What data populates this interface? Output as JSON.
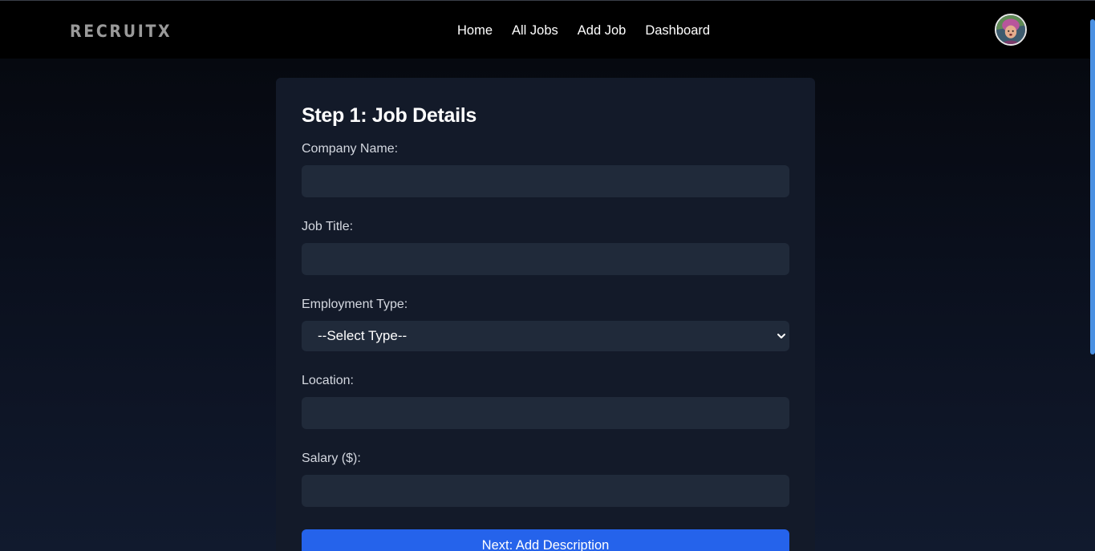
{
  "brand": {
    "logo_text": "RECRUITX"
  },
  "nav": {
    "items": [
      {
        "label": "Home"
      },
      {
        "label": "All Jobs"
      },
      {
        "label": "Add Job"
      },
      {
        "label": "Dashboard"
      }
    ]
  },
  "user": {
    "avatar_icon": "user-avatar"
  },
  "form": {
    "title": "Step 1: Job Details",
    "fields": {
      "company": {
        "label": "Company Name:",
        "value": "",
        "placeholder": ""
      },
      "job_title": {
        "label": "Job Title:",
        "value": "",
        "placeholder": ""
      },
      "employment_type": {
        "label": "Employment Type:",
        "selected": "--Select Type--"
      },
      "location": {
        "label": "Location:",
        "value": "",
        "placeholder": ""
      },
      "salary": {
        "label": "Salary ($):",
        "value": "",
        "placeholder": ""
      }
    },
    "submit_label": "Next: Add Description"
  },
  "colors": {
    "accent": "#2563eb",
    "navbar_bg": "#000000",
    "card_bg": "#131a29",
    "input_bg": "#202a3a",
    "scrollbar": "#4a90e2"
  }
}
